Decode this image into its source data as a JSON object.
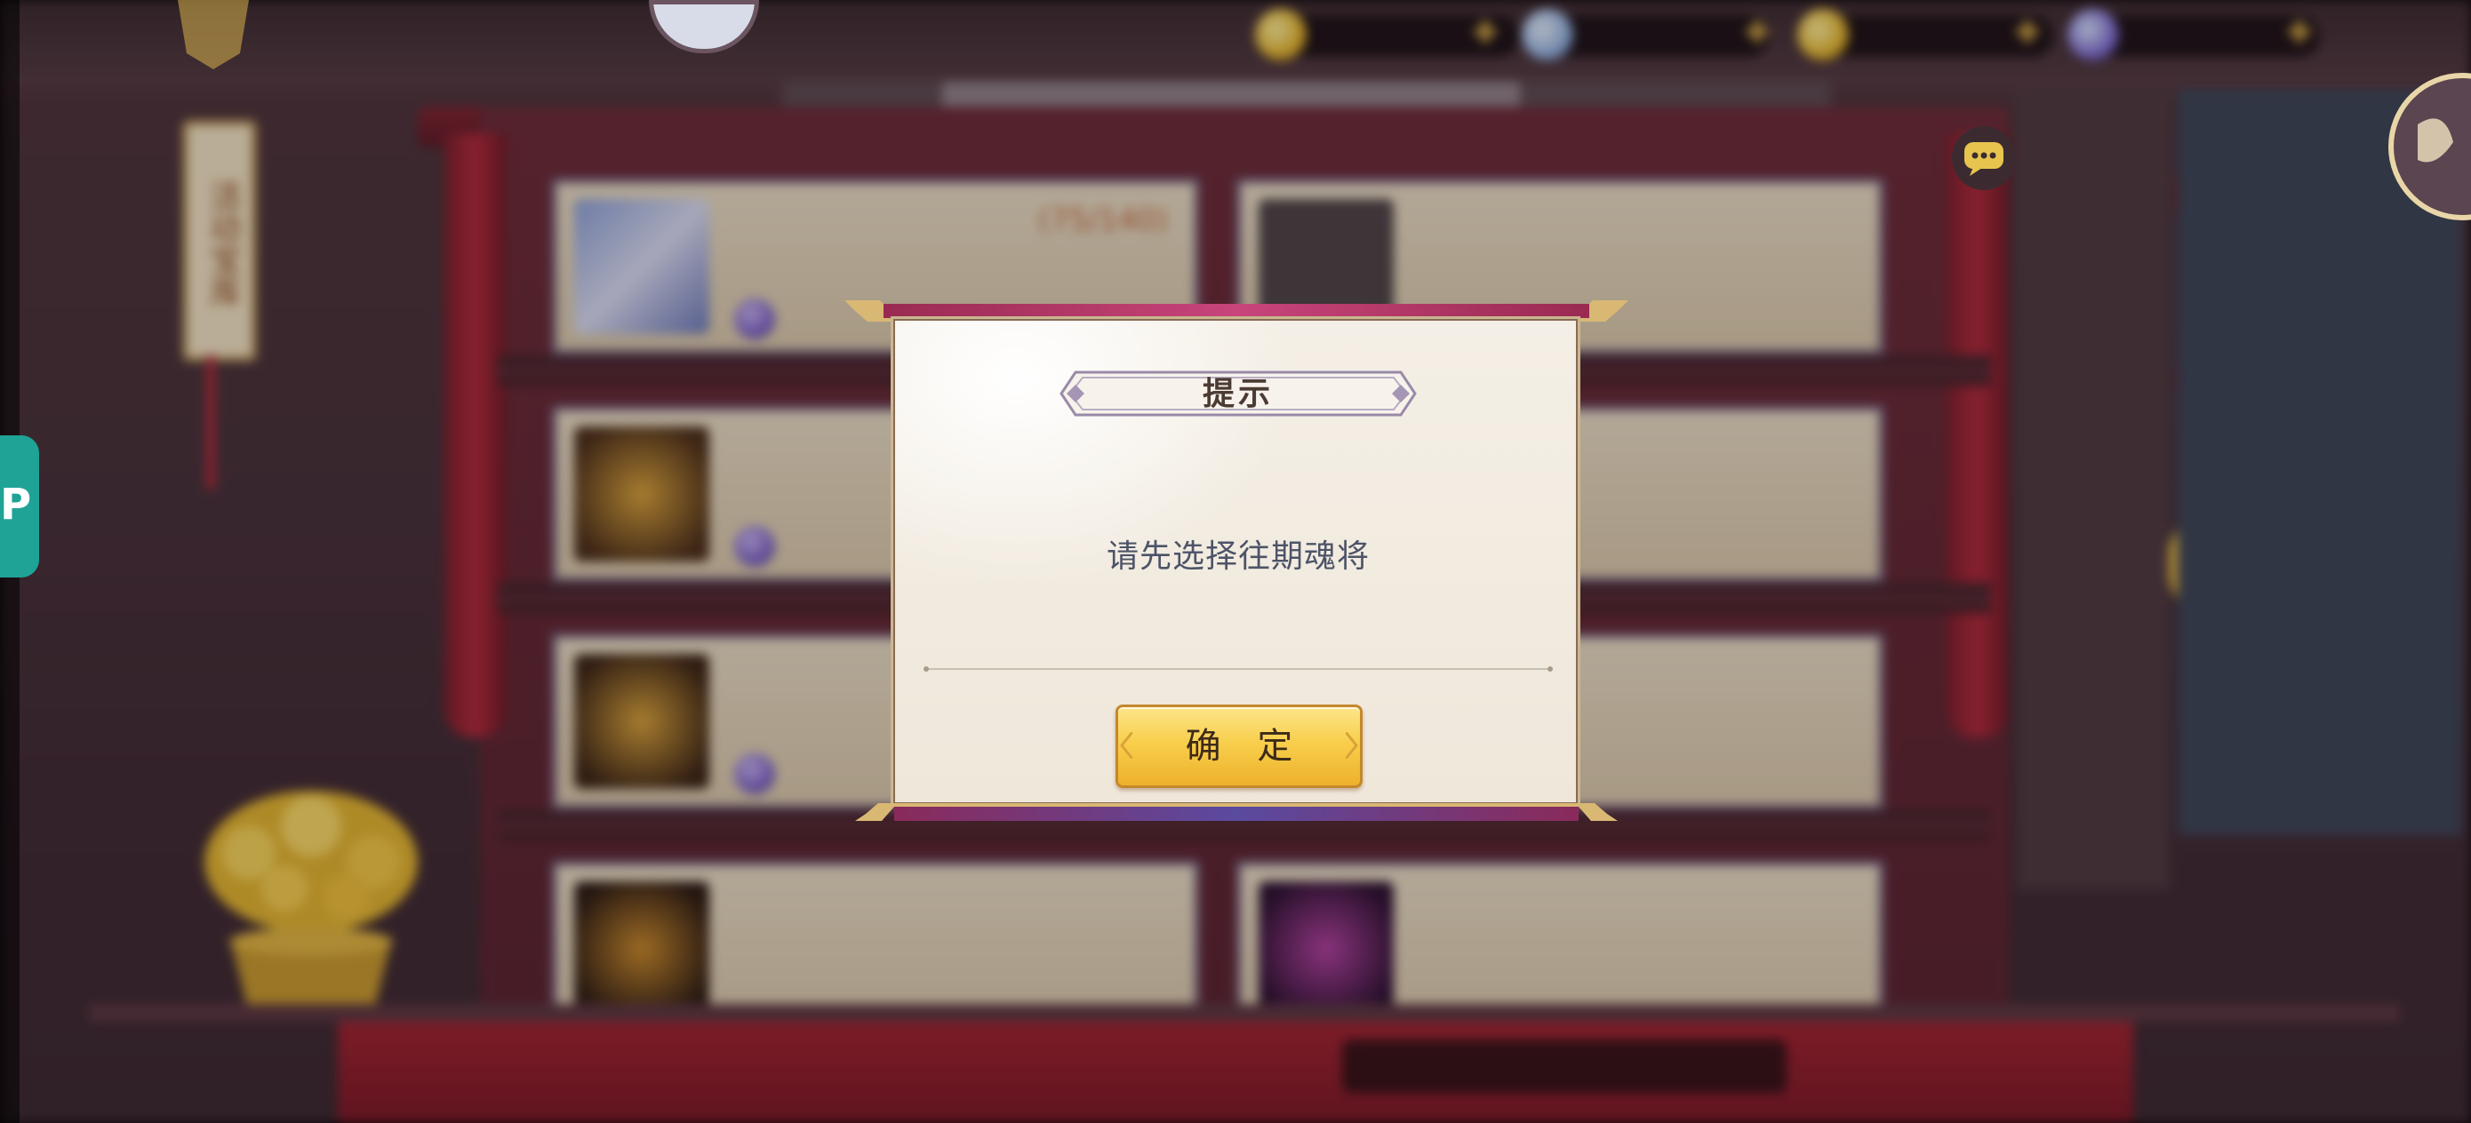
{
  "dialog": {
    "title": "提示",
    "message": "请先选择往期魂将",
    "confirm_label": "确 定"
  },
  "background": {
    "banner_text": "活动宝库",
    "cards": [
      {
        "title": "",
        "count": "(75/140)",
        "subtitle": "",
        "price": ""
      },
      {
        "title": "",
        "count": "",
        "subtitle": "",
        "price": ""
      },
      {
        "title": "",
        "count": "",
        "subtitle": "",
        "price": ""
      },
      {
        "title": "",
        "count": "",
        "subtitle": "",
        "price": ""
      },
      {
        "title": "",
        "count": "",
        "subtitle": "",
        "price": ""
      },
      {
        "title": "",
        "count": "",
        "subtitle": "",
        "price": ""
      },
      {
        "title": "",
        "count": "",
        "subtitle": "",
        "price": ""
      },
      {
        "title": "",
        "count": "",
        "subtitle": "",
        "price": ""
      }
    ],
    "hud_resources": [
      {
        "icon": "gold-ingot-icon",
        "value": ""
      },
      {
        "icon": "blue-gem-icon",
        "value": ""
      },
      {
        "icon": "gold-ingot-icon",
        "value": ""
      },
      {
        "icon": "purple-gem-icon",
        "value": ""
      }
    ],
    "timer_text": ""
  },
  "icons": {
    "chat": "chat-bubble-icon",
    "left_tab": "p-icon"
  },
  "colors": {
    "confirm_gold": "#f8cf4c",
    "dialog_bg": "#f4efe6",
    "frame_red": "#a32331",
    "message_text": "#4d5468"
  }
}
